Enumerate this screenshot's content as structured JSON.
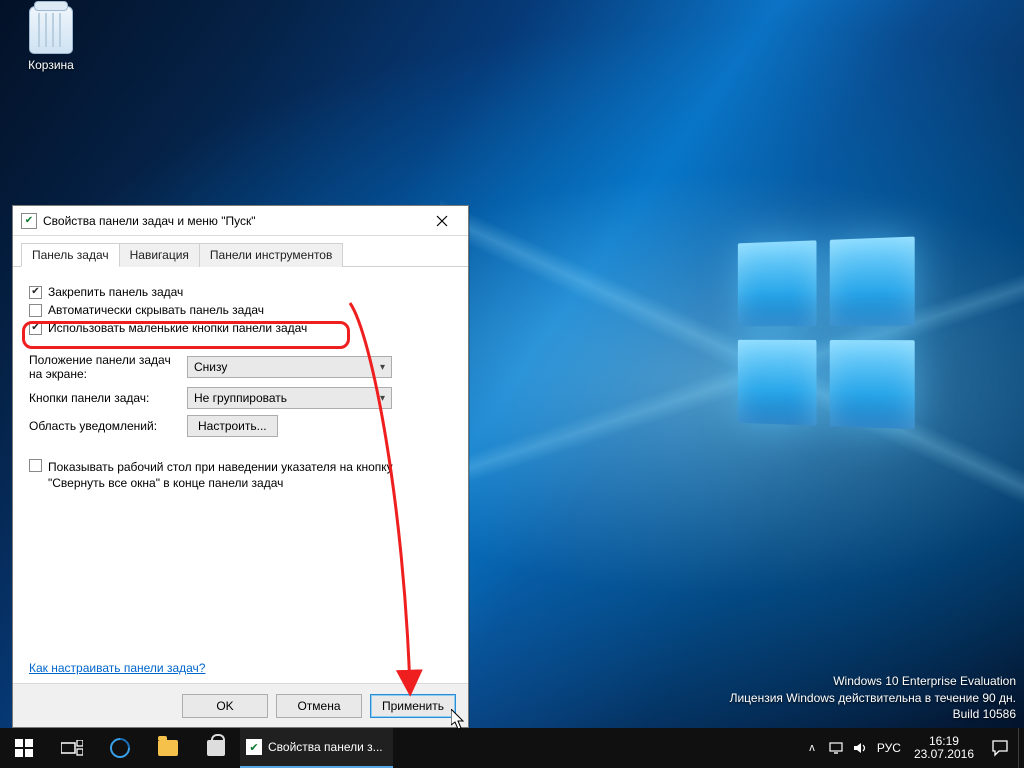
{
  "desktop": {
    "recycle_label": "Корзина"
  },
  "watermark": {
    "line1": "Windows 10 Enterprise Evaluation",
    "line2": "Лицензия Windows действительна в течение 90 дн.",
    "line3": "Build 10586"
  },
  "taskbar": {
    "running_item": "Свойства панели з...",
    "lang": "РУС",
    "time": "16:19",
    "date": "23.07.2016"
  },
  "dialog": {
    "title": "Свойства панели задач и меню \"Пуск\"",
    "tabs": [
      "Панель задач",
      "Навигация",
      "Панели инструментов"
    ],
    "checks": {
      "lock": "Закрепить панель задач",
      "autohide": "Автоматически скрывать панель задач",
      "smallbtns": "Использовать маленькие кнопки панели задач"
    },
    "position_label": "Положение панели задач на экране:",
    "position_value": "Снизу",
    "buttons_label": "Кнопки панели задач:",
    "buttons_value": "Не группировать",
    "notify_label": "Область уведомлений:",
    "notify_button": "Настроить...",
    "peek_label": "Показывать рабочий стол при наведении указателя на кнопку \"Свернуть все окна\" в конце панели задач",
    "help_link": "Как настраивать панели задач?",
    "ok": "OK",
    "cancel": "Отмена",
    "apply": "Применить"
  }
}
